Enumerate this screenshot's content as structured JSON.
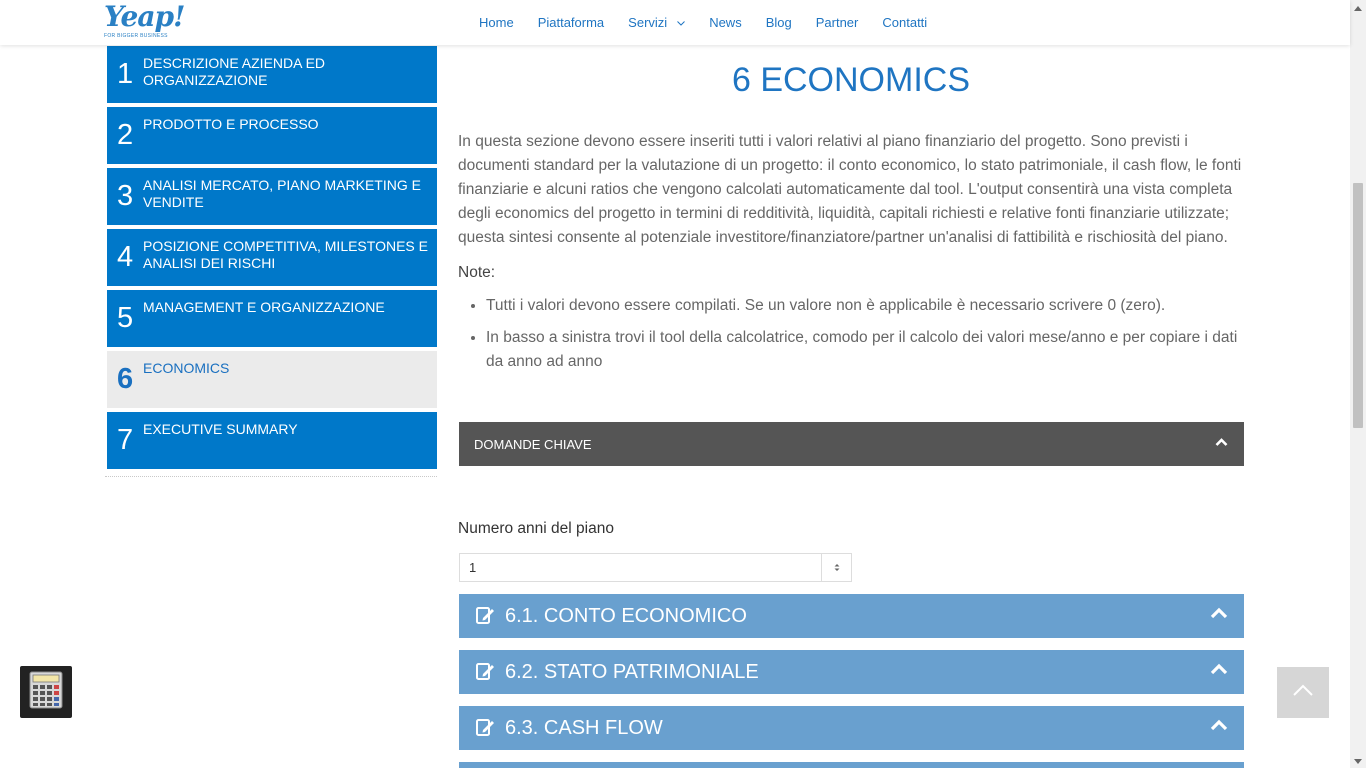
{
  "header": {
    "logo_text": "Yeap!",
    "logo_tagline": "FOR BIGGER BUSINESS",
    "nav": [
      {
        "label": "Home"
      },
      {
        "label": "Piattaforma"
      },
      {
        "label": "Servizi"
      },
      {
        "label": "News"
      },
      {
        "label": "Blog"
      },
      {
        "label": "Partner"
      },
      {
        "label": "Contatti"
      }
    ]
  },
  "sidebar": {
    "items": [
      {
        "num": "1",
        "label": "DESCRIZIONE AZIENDA ED ORGANIZZAZIONE"
      },
      {
        "num": "2",
        "label": "PRODOTTO E PROCESSO"
      },
      {
        "num": "3",
        "label": "ANALISI MERCATO, PIANO MARKETING E VENDITE"
      },
      {
        "num": "4",
        "label": "POSIZIONE COMPETITIVA, MILESTONES E ANALISI DEI RISCHI"
      },
      {
        "num": "5",
        "label": "MANAGEMENT E ORGANIZZAZIONE"
      },
      {
        "num": "6",
        "label": "ECONOMICS"
      },
      {
        "num": "7",
        "label": "EXECUTIVE SUMMARY"
      }
    ],
    "active_index": 5
  },
  "main": {
    "title": "6 ECONOMICS",
    "intro": "In questa sezione devono essere inseriti tutti i valori relativi al piano finanziario del progetto. Sono previsti i documenti standard per la valutazione di un progetto: il conto economico, lo stato patrimoniale, il cash flow, le fonti finanziarie e alcuni ratios che vengono calcolati automaticamente dal tool. L'output consentirà una vista completa degli economics del progetto in termini di redditività, liquidità, capitali richiesti e relative fonti finanziarie utilizzate; questa sintesi consente al potenziale investitore/finanziatore/partner un'analisi di fattibilità e rischiosità del piano.",
    "note_label": "Note",
    "note_colon": ":",
    "notes": [
      "Tutti i valori devono essere compilati. Se un valore non è applicabile è necessario scrivere 0 (zero).",
      "In basso a sinistra trovi il tool della calcolatrice, comodo per il calcolo dei valori mese/anno e per copiare i dati da anno ad anno"
    ],
    "key_questions": "DOMANDE CHIAVE",
    "years_label": "Numero anni del piano",
    "years_value": "1",
    "accordions": [
      {
        "title": "6.1. CONTO ECONOMICO"
      },
      {
        "title": "6.2. STATO PATRIMONIALE"
      },
      {
        "title": "6.3. CASH FLOW"
      }
    ]
  },
  "colors": {
    "primary_blue": "#0078c9",
    "accordion_blue": "#69a0cf",
    "dark_bar": "#555555",
    "active_bg": "#ebebeb"
  },
  "icons": {
    "accordion": "edit-icon",
    "toggle": "chevron-up-icon",
    "calculator": "calculator-icon",
    "back_to_top": "chevron-up-icon"
  }
}
